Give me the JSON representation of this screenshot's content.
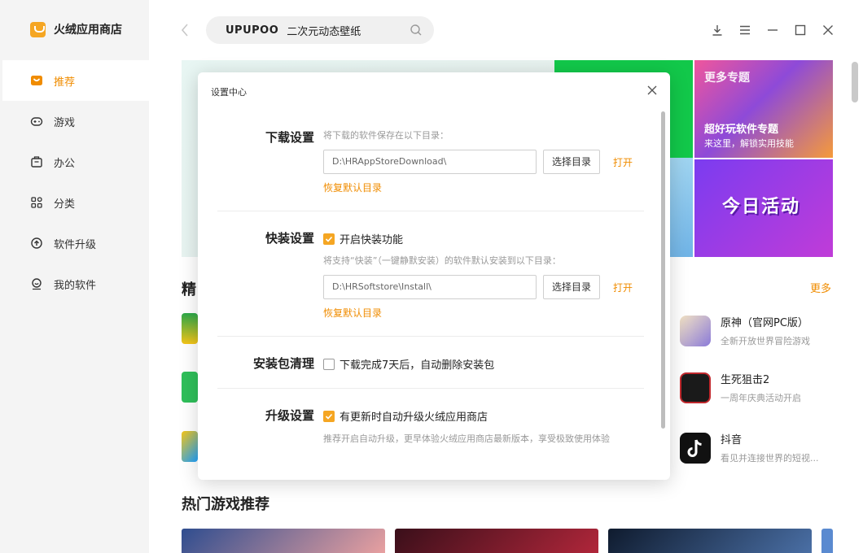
{
  "app": {
    "name": "火绒应用商店",
    "accent": "#f08c00"
  },
  "sidebar": {
    "items": [
      {
        "label": "推荐",
        "icon": "recommend-icon",
        "active": true
      },
      {
        "label": "游戏",
        "icon": "gamepad-icon",
        "active": false
      },
      {
        "label": "办公",
        "icon": "briefcase-icon",
        "active": false
      },
      {
        "label": "分类",
        "icon": "category-grid-icon",
        "active": false
      },
      {
        "label": "软件升级",
        "icon": "upgrade-icon",
        "active": false
      },
      {
        "label": "我的软件",
        "icon": "my-software-icon",
        "active": false
      }
    ]
  },
  "search": {
    "brand": "UPUPOO",
    "query": "二次元动态壁纸"
  },
  "window_controls": [
    "download-icon",
    "menu-icon",
    "minimize-icon",
    "maximize-icon",
    "close-icon"
  ],
  "banners": {
    "promo1": {
      "tag": "更多专题",
      "title": "超好玩软件专题",
      "subtitle": "来这里，解锁实用技能"
    },
    "promo2": {
      "title": "今日活动"
    }
  },
  "featured": {
    "title_partial": "精",
    "more": "更多",
    "apps": [
      {
        "name": "原神（官网PC版）",
        "desc": "全新开放世界冒险游戏"
      },
      {
        "name": "生死狙击2",
        "desc": "一周年庆典活动开启"
      },
      {
        "name": "抖音",
        "desc": "看见并连接世界的短视..."
      }
    ]
  },
  "hot_games": {
    "title": "热门游戏推荐"
  },
  "settings": {
    "title": "设置中心",
    "download": {
      "label": "下载设置",
      "hint": "将下载的软件保存在以下目录：",
      "path": "D:\\HRAppStoreDownload\\",
      "choose": "选择目录",
      "open": "打开",
      "restore": "恢复默认目录"
    },
    "quick_install": {
      "label": "快装设置",
      "checkbox": "开启快装功能",
      "checked": true,
      "hint": "将支持“快装”（一键静默安装）的软件默认安装到以下目录：",
      "path": "D:\\HRSoftstore\\Install\\",
      "choose": "选择目录",
      "open": "打开",
      "restore": "恢复默认目录"
    },
    "cleanup": {
      "label": "安装包清理",
      "checkbox": "下载完成7天后，自动删除安装包",
      "checked": false
    },
    "upgrade": {
      "label": "升级设置",
      "checkbox": "有更新时自动升级火绒应用商店",
      "checked": true,
      "hint": "推荐开启自动升级，更早体验火绒应用商店最新版本，享受极致使用体验"
    }
  }
}
